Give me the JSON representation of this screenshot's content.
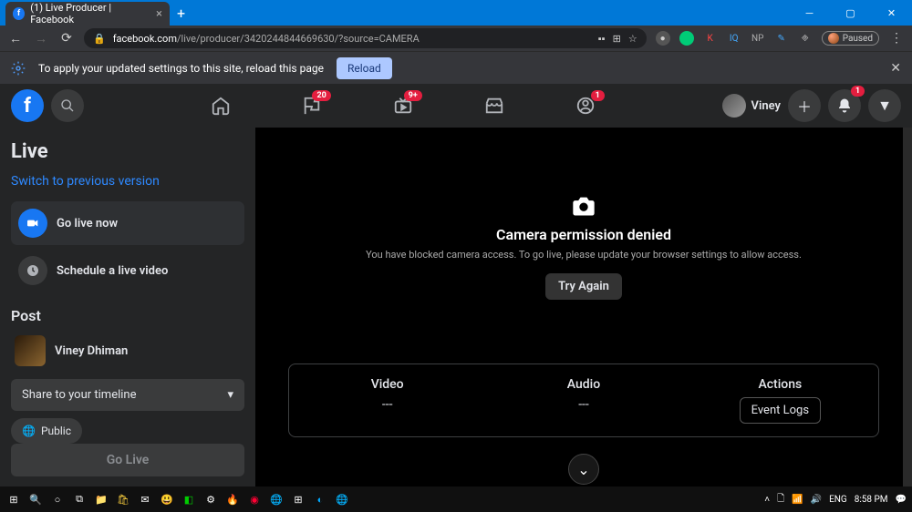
{
  "browser": {
    "tab_title": "(1) Live Producer | Facebook",
    "url_host": "facebook.com",
    "url_path": "/live/producer/3420244844669630/?source=CAMERA",
    "paused_label": "Paused"
  },
  "infobar": {
    "message": "To apply your updated settings to this site, reload this page",
    "reload": "Reload"
  },
  "fb_nav": {
    "badges": {
      "pages": "20",
      "watch": "9+",
      "groups": "1",
      "notifications": "1"
    },
    "profile_name": "Viney"
  },
  "sidebar": {
    "title": "Live",
    "switch_link": "Switch to previous version",
    "go_live_item": "Go live now",
    "schedule_item": "Schedule a live video",
    "post_heading": "Post",
    "user_name": "Viney Dhiman",
    "share_label": "Share to your timeline",
    "privacy_label": "Public",
    "go_live_btn": "Go Live"
  },
  "main": {
    "error_title": "Camera permission denied",
    "error_sub": "You have blocked camera access. To go live, please update your browser settings to allow access.",
    "try_again": "Try Again",
    "panel": {
      "video_h": "Video",
      "video_v": "---",
      "audio_h": "Audio",
      "audio_v": "---",
      "actions_h": "Actions",
      "event_logs": "Event Logs"
    }
  },
  "taskbar": {
    "lang": "ENG",
    "time": "8:58 PM"
  }
}
